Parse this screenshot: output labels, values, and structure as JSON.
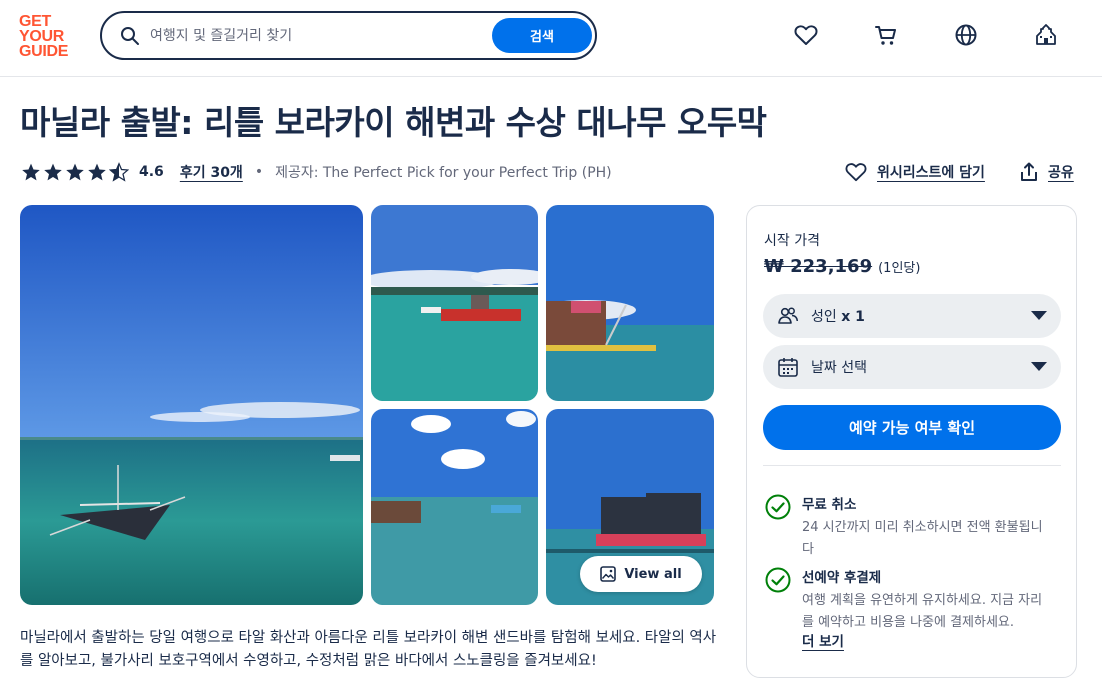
{
  "header": {
    "logo_lines": [
      "GET",
      "YOUR",
      "GUIDE"
    ],
    "search_placeholder": "여행지 및 즐길거리 찾기",
    "search_button": "검색",
    "icons": [
      "heart-icon",
      "cart-icon",
      "globe-icon",
      "account-icon"
    ]
  },
  "activity": {
    "title": "마닐라 출발: 리틀 보라카이 해변과 수상 대나무 오두막",
    "rating": "4.6",
    "reviews_label": "후기 30개",
    "provider": "제공자: The Perfect Pick for your Perfect Trip (PH)",
    "wishlist_label": "위시리스트에 담기",
    "share_label": "공유"
  },
  "gallery": {
    "view_all_label": "View all"
  },
  "description": "마닐라에서 출발하는 당일 여행으로 타알 화산과 아름다운 리틀 보라카이 해변 샌드바를 탐험해 보세요. 타알의 역사를 알아보고, 불가사리 보호구역에서 수영하고, 수정처럼 맑은 바다에서 스노클링을 즐겨보세요!",
  "booking": {
    "price_label": "시작 가격",
    "price": "₩ 223,169",
    "price_unit": "(1인당)",
    "participants_label": "성인",
    "participants_count": "x 1",
    "date_label": "날짜 선택",
    "cta": "예약 가능 여부 확인",
    "features": [
      {
        "title": "무료 취소",
        "desc": "24 시간까지 미리 취소하시면 전액 환불됩니다"
      },
      {
        "title": "선예약 후결제",
        "desc": "여행 계획을 유연하게 유지하세요. 지금 자리를 예약하고 비용을 나중에 결제하세요."
      }
    ],
    "more_label": "더 보기"
  },
  "colors": {
    "brand": "#ff5533",
    "primary": "#0071eb",
    "text": "#1a2b49",
    "check": "#008009"
  }
}
